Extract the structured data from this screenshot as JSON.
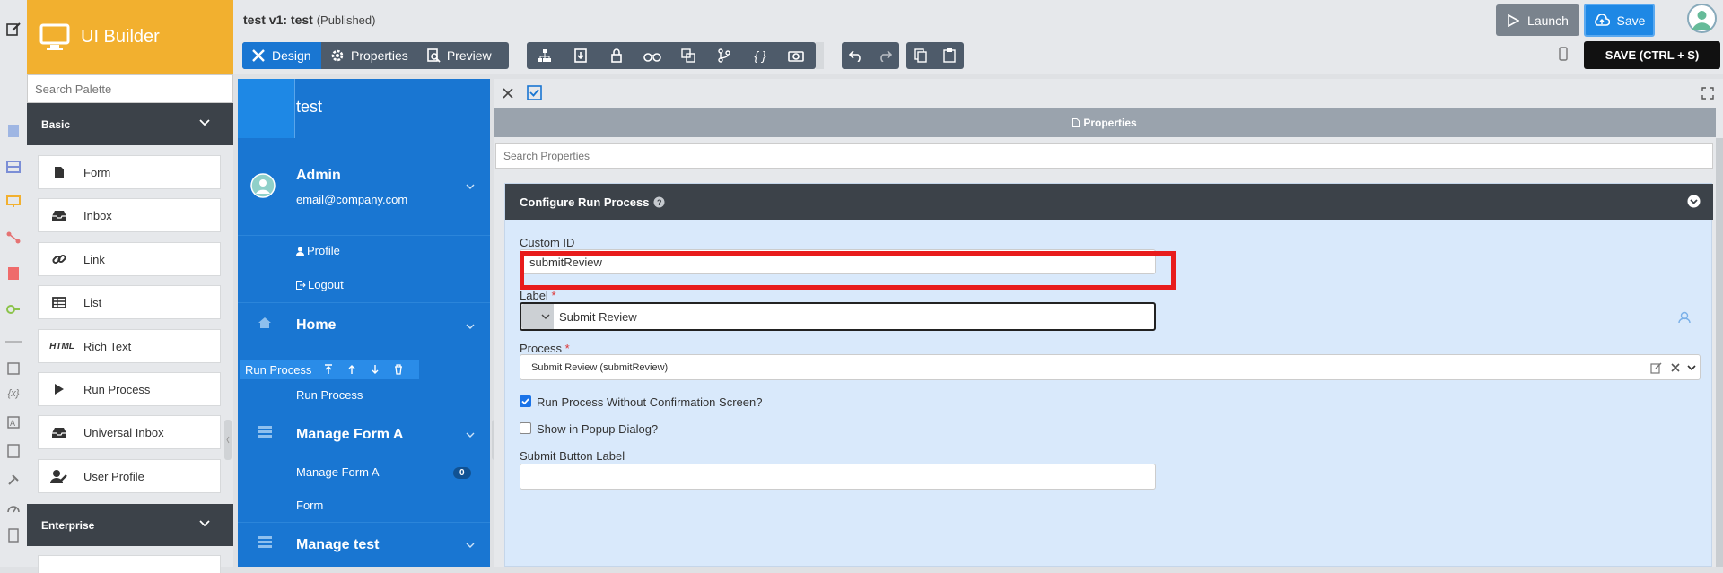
{
  "header": {
    "brand": "UI Builder",
    "app_title": "test v1: test",
    "app_status": "(Published)",
    "tabs": [
      {
        "label": "Design"
      },
      {
        "label": "Properties"
      },
      {
        "label": "Preview"
      }
    ],
    "launch_label": "Launch",
    "save_label": "Save",
    "save_tooltip": "SAVE (CTRL + S)",
    "toolbar_icons": [
      "tree-icon",
      "export-icon",
      "lock-icon",
      "binoculars-icon",
      "translate-icon",
      "branch-icon",
      "code-braces-icon",
      "camera-icon",
      "undo-icon",
      "redo-icon",
      "copy-icon",
      "paste-icon"
    ]
  },
  "palette": {
    "search_placeholder": "Search Palette",
    "sections": [
      {
        "label": "Basic"
      },
      {
        "label": "Enterprise"
      }
    ],
    "items": [
      {
        "label": "Form",
        "icon": "form-icon"
      },
      {
        "label": "Inbox",
        "icon": "inbox-icon"
      },
      {
        "label": "Link",
        "icon": "link-icon"
      },
      {
        "label": "List",
        "icon": "table-icon"
      },
      {
        "label": "Rich Text",
        "icon": "html-icon",
        "icon_text": "HTML"
      },
      {
        "label": "Run Process",
        "icon": "play-icon"
      },
      {
        "label": "Universal Inbox",
        "icon": "inbox-icon"
      },
      {
        "label": "User Profile",
        "icon": "user-edit-icon"
      }
    ]
  },
  "canvas": {
    "title": "test",
    "user_name": "Admin",
    "user_email": "email@company.com",
    "profile": "Profile",
    "logout": "Logout",
    "home": "Home",
    "selected_bar_label": "Run Process",
    "run_process": "Run Process",
    "manage_form_a": "Manage Form A",
    "manage_form_a_sub": "Manage Form A",
    "manage_form_a_count": "0",
    "form_sub": "Form",
    "manage_test": "Manage test"
  },
  "properties": {
    "title": "Properties",
    "search_placeholder": "Search Properties",
    "section_title": "Configure Run Process",
    "custom_id_label": "Custom ID",
    "custom_id_value": "submitReview",
    "label_label": "Label",
    "label_value": "Submit Review",
    "process_label": "Process",
    "process_value": "Submit Review (submitReview)",
    "no_confirm_label": "Run Process Without Confirmation Screen?",
    "no_confirm_checked": true,
    "popup_label": "Show in Popup Dialog?",
    "popup_checked": false,
    "submit_button_label": "Submit Button Label",
    "submit_button_value": "",
    "required_mark": "*"
  },
  "colors": {
    "brand": "#f2b02f",
    "primary": "#1976d2",
    "highlight": "#e81c1c",
    "dark": "#3c4249"
  }
}
